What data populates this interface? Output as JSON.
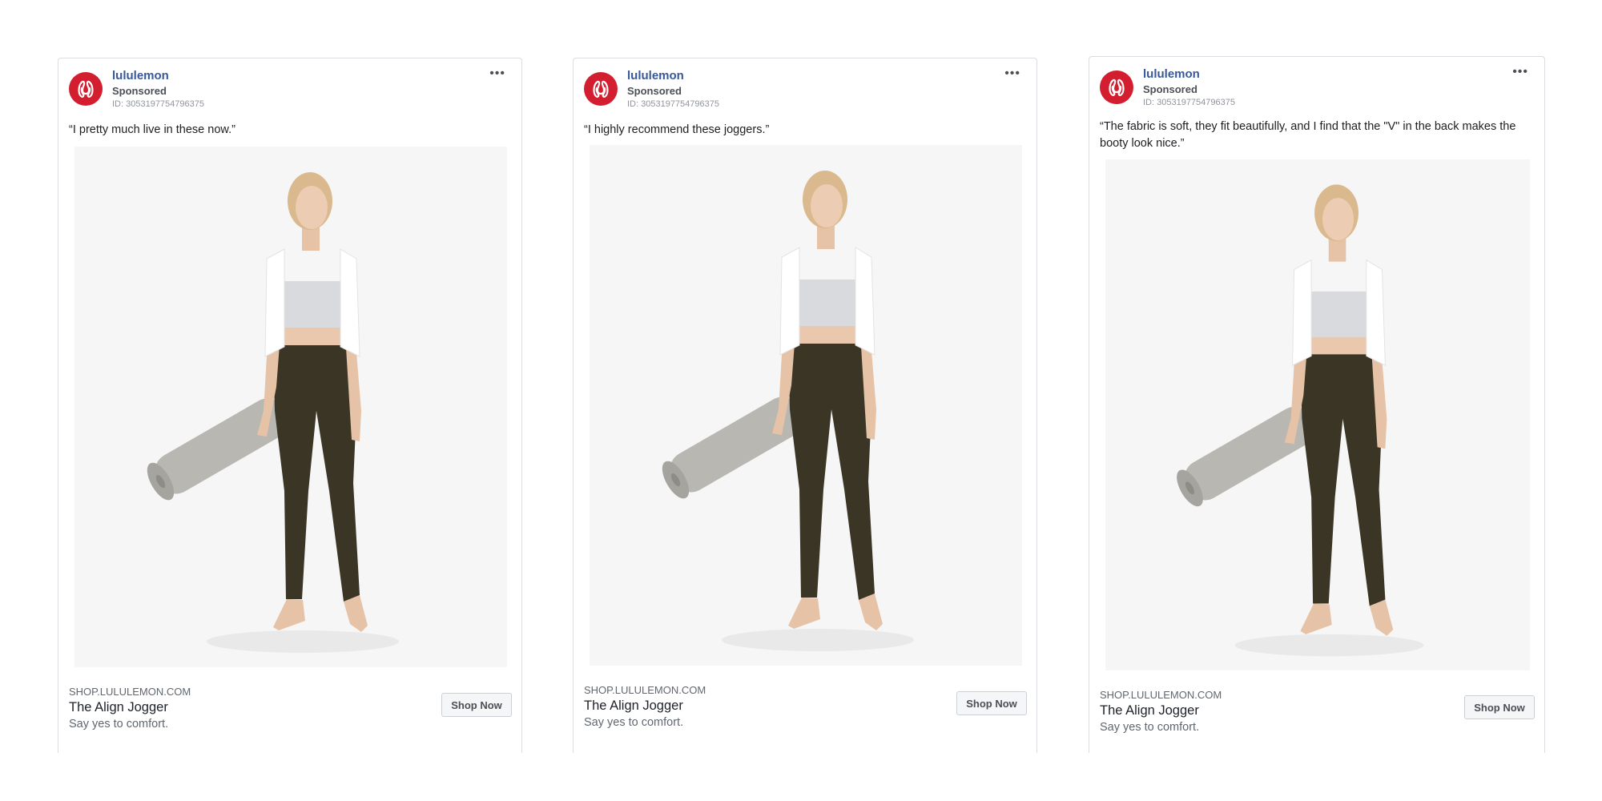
{
  "brand_color": "#d31e2f",
  "link_color": "#385898",
  "ads": [
    {
      "page_name": "lululemon",
      "sponsored": "Sponsored",
      "ad_id": "ID: 3053197754796375",
      "more_icon": "ellipsis-icon",
      "body": "“I pretty much live in these now.”",
      "domain": "SHOP.LULULEMON.COM",
      "headline": "The Align Jogger",
      "description": "Say yes to comfort.",
      "cta": "Shop Now"
    },
    {
      "page_name": "lululemon",
      "sponsored": "Sponsored",
      "ad_id": "ID: 3053197754796375",
      "more_icon": "ellipsis-icon",
      "body": "“I highly recommend these joggers.”",
      "domain": "SHOP.LULULEMON.COM",
      "headline": "The Align Jogger",
      "description": "Say yes to comfort.",
      "cta": "Shop Now"
    },
    {
      "page_name": "lululemon",
      "sponsored": "Sponsored",
      "ad_id": "ID: 3053197754796375",
      "more_icon": "ellipsis-icon",
      "body": "“The fabric is soft, they fit beautifully, and I find that the \"V\" in the back makes the booty look nice.”",
      "domain": "SHOP.LULULEMON.COM",
      "headline": "The Align Jogger",
      "description": "Say yes to comfort.",
      "cta": "Shop Now"
    }
  ]
}
